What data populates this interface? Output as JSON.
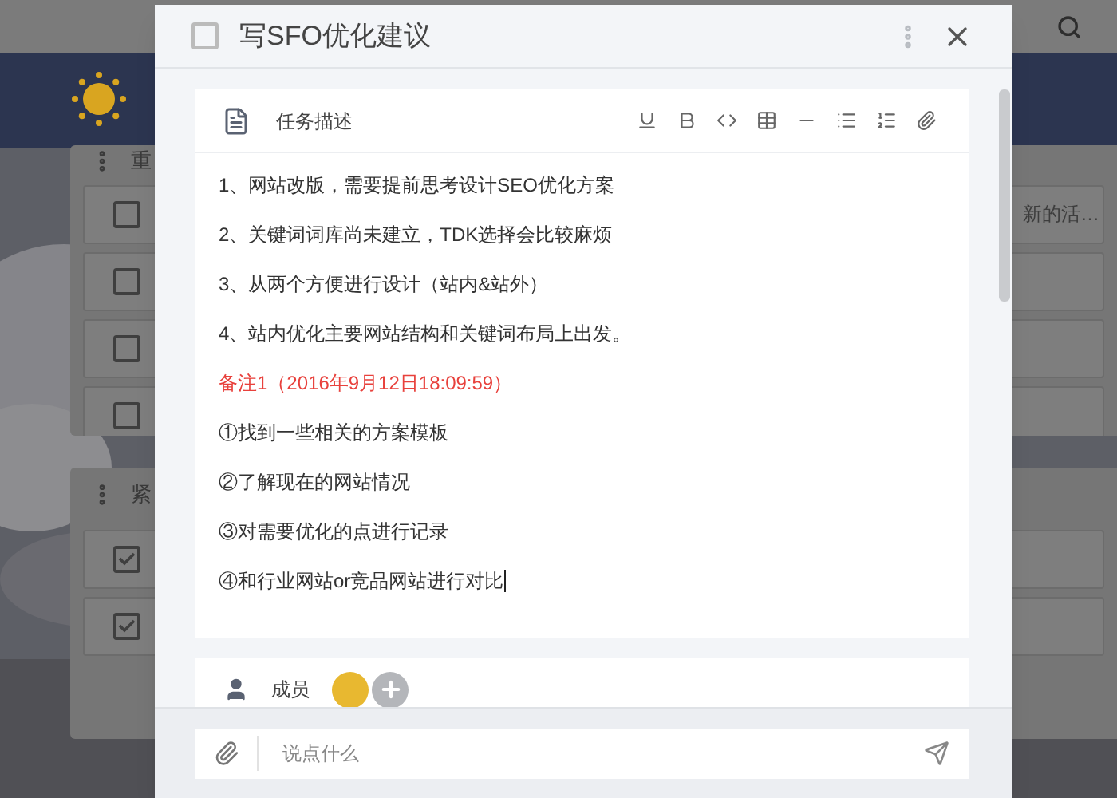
{
  "background": {
    "panels": [
      {
        "title": "重",
        "rows": [
          {
            "checked": false,
            "text": "新的活…"
          },
          {
            "checked": false
          },
          {
            "checked": false
          },
          {
            "checked": false
          }
        ]
      },
      {
        "title": "紧",
        "rows": [
          {
            "checked": true
          },
          {
            "checked": true
          }
        ]
      }
    ]
  },
  "dialog": {
    "title": "写SFO优化建议",
    "done": false,
    "section_label": "任务描述",
    "lines": [
      {
        "kind": "normal",
        "text": "1、网站改版，需要提前思考设计SEO优化方案"
      },
      {
        "kind": "normal",
        "text": "2、关键词词库尚未建立，TDK选择会比较麻烦"
      },
      {
        "kind": "normal",
        "text": "3、从两个方便进行设计（站内&站外）"
      },
      {
        "kind": "normal",
        "text": "4、站内优化主要网站结构和关键词布局上出发。"
      },
      {
        "kind": "note",
        "text": "备注1（2016年9月12日18:09:59）"
      },
      {
        "kind": "normal",
        "text": "①找到一些相关的方案模板"
      },
      {
        "kind": "normal",
        "text": "②了解现在的网站情况"
      },
      {
        "kind": "normal",
        "text": "③对需要优化的点进行记录"
      },
      {
        "kind": "normal",
        "text": "④和行业网站or竞品网站进行对比"
      }
    ],
    "members_label": "成员",
    "comment": {
      "placeholder": "说点什么"
    }
  }
}
